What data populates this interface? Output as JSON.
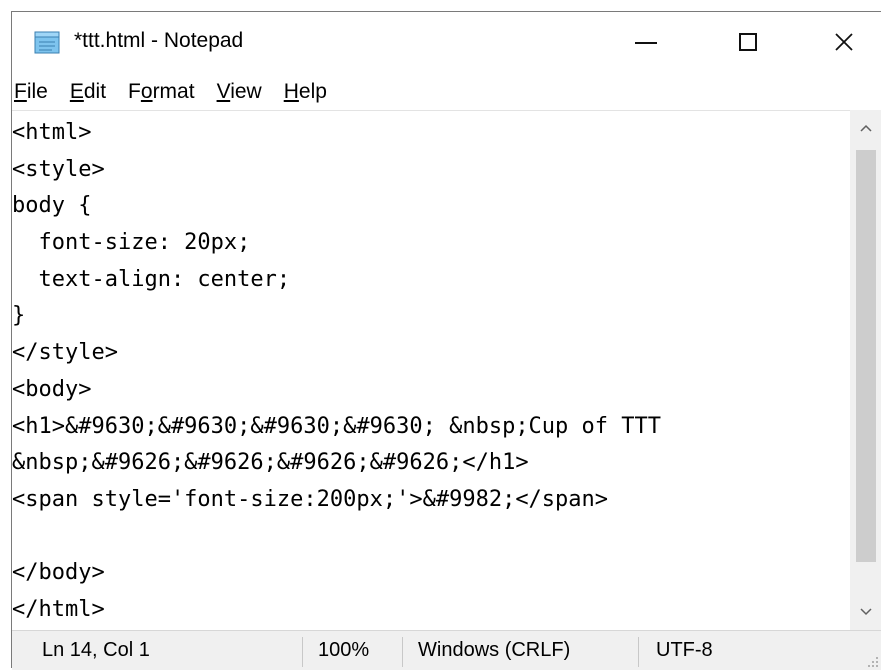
{
  "window": {
    "title": "*ttt.html - Notepad",
    "icon": "notepad-icon",
    "controls": {
      "minimize": "minimize-icon",
      "maximize": "maximize-icon",
      "close_glyph": "✕"
    }
  },
  "menu": {
    "items": [
      {
        "mnemonic": "F",
        "rest": "ile"
      },
      {
        "mnemonic": "E",
        "rest": "dit"
      },
      {
        "pre": "F",
        "mnemonic": "o",
        "rest": "rmat"
      },
      {
        "mnemonic": "V",
        "rest": "iew"
      },
      {
        "mnemonic": "H",
        "rest": "elp"
      }
    ]
  },
  "editor": {
    "lines": [
      "<html>",
      "<style>",
      "body {",
      "  font-size: 20px;",
      "  text-align: center;",
      "}",
      "</style>",
      "<body>",
      "<h1>&#9630;&#9630;&#9630;&#9630; &nbsp;Cup of TTT",
      "&nbsp;&#9626;&#9626;&#9626;&#9626;</h1>",
      "<span style='font-size:200px;'>&#9982;</span>",
      "",
      "</body>",
      "</html>"
    ]
  },
  "scrollbar": {
    "up_glyph": "^",
    "down_glyph": "v"
  },
  "status": {
    "position": "Ln 14, Col 1",
    "zoom": "100%",
    "line_endings": "Windows (CRLF)",
    "encoding": "UTF-8"
  },
  "colors": {
    "text": "#000000",
    "chrome": "#f0f0f0",
    "scroll_thumb": "#cdcdcd"
  }
}
